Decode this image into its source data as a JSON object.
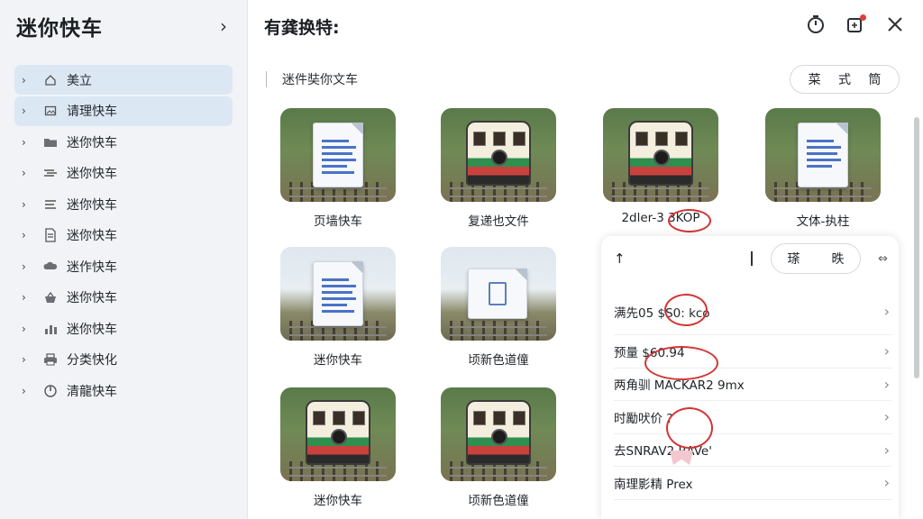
{
  "sidebar": {
    "title": "迷你快车",
    "items": [
      {
        "label": "美立",
        "icon": "home-icon",
        "active": true
      },
      {
        "label": "请理快车",
        "icon": "image-icon",
        "active": true
      },
      {
        "label": "迷你快车",
        "icon": "folder-icon"
      },
      {
        "label": "迷你快车",
        "icon": "network-icon"
      },
      {
        "label": "迷你快车",
        "icon": "list-icon"
      },
      {
        "label": "迷你快车",
        "icon": "document-icon"
      },
      {
        "label": "迷作快车",
        "icon": "cloud-lock-icon"
      },
      {
        "label": "迷你快车",
        "icon": "basket-icon"
      },
      {
        "label": "迷你快车",
        "icon": "bar-chart-icon"
      },
      {
        "label": "分类快化",
        "icon": "printer-icon"
      },
      {
        "label": "清龍快车",
        "icon": "gauge-icon"
      }
    ]
  },
  "header": {
    "title": "有龚换特:"
  },
  "toolbar": {
    "path": "迷件奘你文车",
    "filter_labels": [
      "菜",
      "式",
      "筒"
    ]
  },
  "tiles": [
    {
      "label": "页墙快车",
      "kind": "document"
    },
    {
      "label": "复递也文件",
      "kind": "train"
    },
    {
      "label": "2dler-3 3KOP",
      "kind": "train"
    },
    {
      "label": "文体-执柱",
      "kind": "document"
    },
    {
      "label": "迷你快车",
      "kind": "document-sky"
    },
    {
      "label": "顷新色道僮",
      "kind": "folder-sky"
    },
    {
      "label": "迷你快车",
      "kind": "train"
    },
    {
      "label": "顷新色道僮",
      "kind": "train"
    }
  ],
  "panel": {
    "segment_labels": [
      "瑹",
      "昳"
    ],
    "rows": [
      {
        "label": "满先05",
        "value": "$S0: kco"
      },
      {
        "label": "预量",
        "value": "$60.94"
      },
      {
        "label": "两角驯",
        "value": "MACKAR2 9mx"
      },
      {
        "label": "时勵吠价",
        "value": "?"
      },
      {
        "label": "去SNRAV2",
        "value": "RAVe'"
      },
      {
        "label": "南理影精",
        "value": "Prex"
      }
    ]
  },
  "colors": {
    "accent": "#dce7f4",
    "annotation": "#d23535",
    "notification": "#e23b3b"
  }
}
